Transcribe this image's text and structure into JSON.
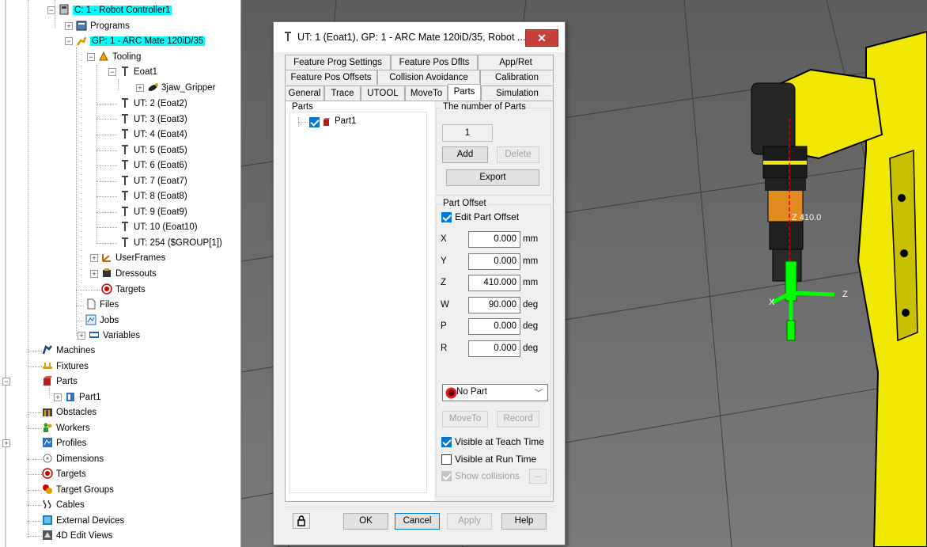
{
  "tree": {
    "robot_controller": "C: 1 - Robot Controller1",
    "programs": "Programs",
    "group": "GP: 1 - ARC Mate 120iD/35",
    "tooling": "Tooling",
    "eoat1": "Eoat1",
    "gripper": "3jaw_Gripper",
    "tools": [
      "UT: 2  (Eoat2)",
      "UT: 3  (Eoat3)",
      "UT: 4  (Eoat4)",
      "UT: 5  (Eoat5)",
      "UT: 6  (Eoat6)",
      "UT: 7  (Eoat7)",
      "UT: 8  (Eoat8)",
      "UT: 9  (Eoat9)",
      "UT: 10  (Eoat10)",
      "UT: 254  ($GROUP[1])"
    ],
    "userframes": "UserFrames",
    "dressouts": "Dressouts",
    "targets_sub": "Targets",
    "files": "Files",
    "jobs": "Jobs",
    "variables": "Variables",
    "machines": "Machines",
    "fixtures": "Fixtures",
    "parts": "Parts",
    "part1": "Part1",
    "obstacles": "Obstacles",
    "workers": "Workers",
    "profiles": "Profiles",
    "dimensions": "Dimensions",
    "targets": "Targets",
    "target_groups": "Target Groups",
    "cables": "Cables",
    "external_devices": "External Devices",
    "edit_views": "4D Edit Views"
  },
  "dialog": {
    "title": "UT: 1  (Eoat1), GP: 1 - ARC Mate 120iD/35, Robot ...",
    "close": "✕",
    "tabs_row1": [
      "Feature Prog Settings",
      "Feature Pos Dflts",
      "App/Ret"
    ],
    "tabs_row2": [
      "Feature Pos Offsets",
      "Collision Avoidance",
      "Calibration"
    ],
    "tabs_row3": [
      "General",
      "Trace",
      "UTOOL",
      "MoveTo",
      "Parts",
      "Simulation"
    ],
    "parts_group": "Parts",
    "part_item": "Part1",
    "count_group": "The number of Parts",
    "count_value": "1",
    "add": "Add",
    "delete": "Delete",
    "export": "Export",
    "offset_group": "Part Offset",
    "edit_offset": "Edit Part Offset",
    "offsets": [
      {
        "axis": "X",
        "value": "0.000",
        "unit": "mm"
      },
      {
        "axis": "Y",
        "value": "0.000",
        "unit": "mm"
      },
      {
        "axis": "Z",
        "value": "410.000",
        "unit": "mm"
      },
      {
        "axis": "W",
        "value": "90.000",
        "unit": "deg"
      },
      {
        "axis": "P",
        "value": "0.000",
        "unit": "deg"
      },
      {
        "axis": "R",
        "value": "0.000",
        "unit": "deg"
      }
    ],
    "part_select": "No Part",
    "moveto": "MoveTo",
    "record": "Record",
    "visible_teach": "Visible at Teach Time",
    "visible_run": "Visible at Run Time",
    "show_collisions": "Show collisions",
    "ellipsis": "...",
    "ok": "OK",
    "cancel": "Cancel",
    "apply": "Apply",
    "help": "Help"
  },
  "viewport": {
    "z_label": "Z 410.0",
    "axis_z": "Z",
    "axis_x": "X"
  },
  "colors": {
    "highlight": "#00ffff",
    "robot_yellow": "#f0e800",
    "frame_green": "#00ff00",
    "close_red": "#c7413a",
    "check_blue": "#0078d7"
  }
}
